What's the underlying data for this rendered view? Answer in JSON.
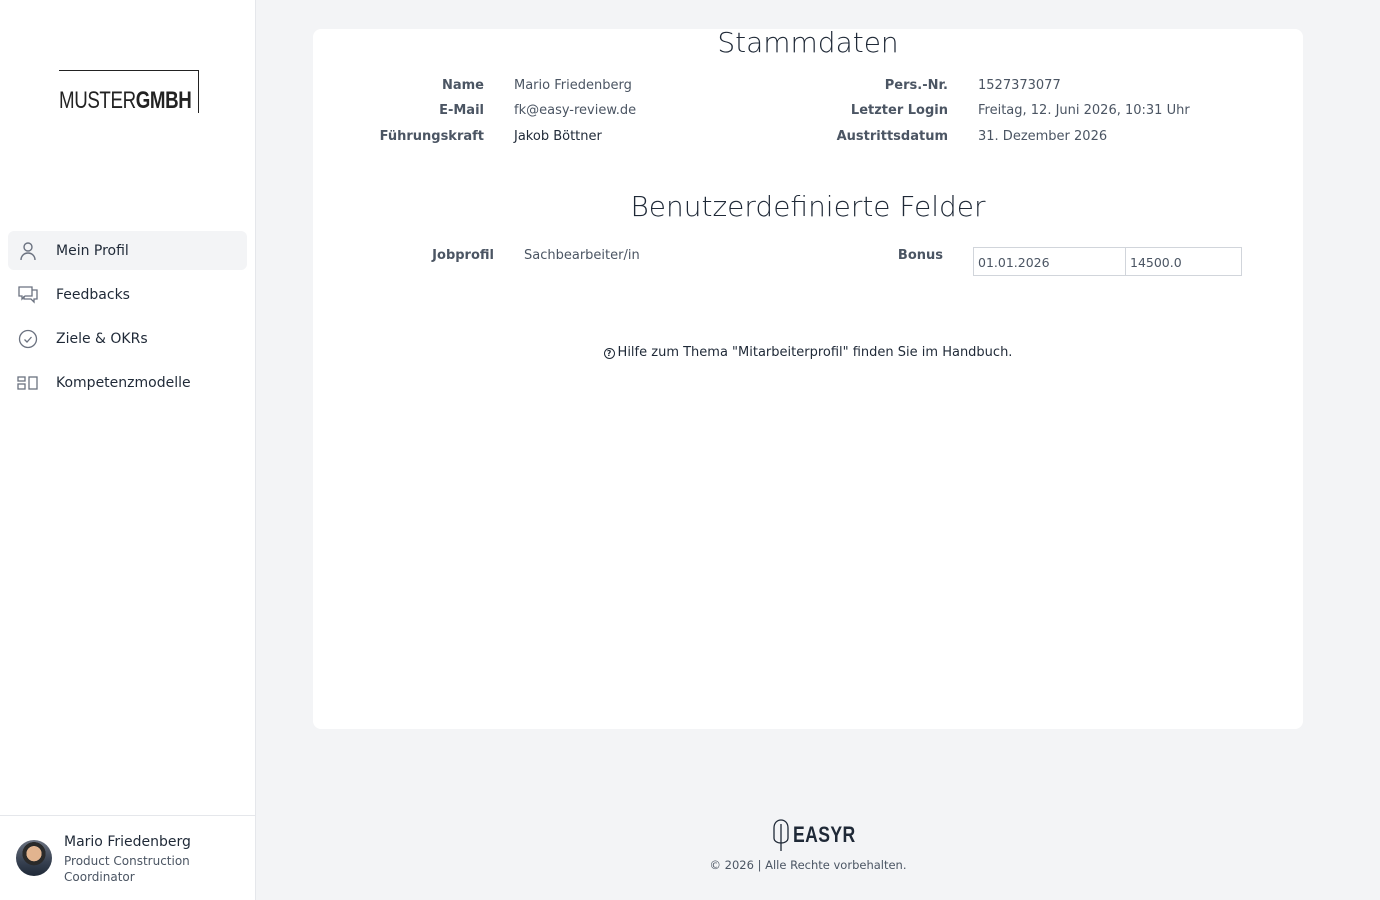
{
  "sidebar": {
    "logo": {
      "light": "MUSTER",
      "bold": "GMBH"
    },
    "items": [
      {
        "label": "Mein Profil",
        "icon": "user-icon",
        "active": true
      },
      {
        "label": "Feedbacks",
        "icon": "chat-bubbles-icon",
        "active": false
      },
      {
        "label": "Ziele & OKRs",
        "icon": "check-circle-icon",
        "active": false
      },
      {
        "label": "Kompetenzmodelle",
        "icon": "blocks-icon",
        "active": false
      }
    ],
    "user": {
      "name": "Mario Friedenberg",
      "role": "Product Construction Coordinator"
    }
  },
  "master_data": {
    "title": "Stammdaten",
    "name_label": "Name",
    "name_value": "Mario Friedenberg",
    "email_label": "E-Mail",
    "email_value": "fk@easy-review.de",
    "manager_label": "Führungskraft",
    "manager_value": "Jakob Böttner",
    "pers_label": "Pers.-Nr.",
    "pers_value": "1527373077",
    "login_label": "Letzter Login",
    "login_value": "Freitag, 12. Juni 2026, 10:31 Uhr",
    "exit_label": "Austrittsdatum",
    "exit_value": "31. Dezember 2026"
  },
  "custom_fields": {
    "title": "Benutzerdefinierte Felder",
    "jobprofile_label": "Jobprofil",
    "jobprofile_value": "Sachbearbeiter/in",
    "bonus_label": "Bonus",
    "bonus_date": "01.01.2026",
    "bonus_amount": "14500.0"
  },
  "help_text": "Hilfe zum Thema \"Mitarbeiterprofil\" finden Sie im Handbuch.",
  "footer": {
    "brand": "EASYR",
    "copyright": "© 2026 | Alle Rechte vorbehalten."
  }
}
